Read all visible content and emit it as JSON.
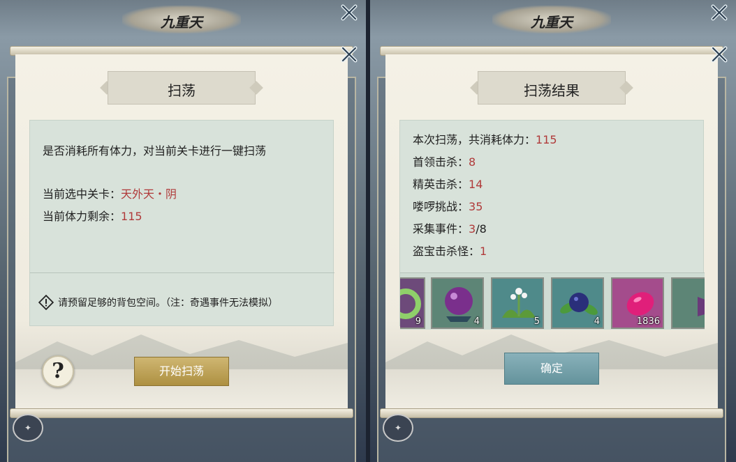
{
  "top_banner_title": "九重天",
  "left": {
    "dialog_title": "扫荡",
    "message": "是否消耗所有体力，对当前关卡进行一键扫荡",
    "selected_stage_label": "当前选中关卡：",
    "selected_stage_value": "天外天・阴",
    "stamina_label": "当前体力剩余：",
    "stamina_value": "115",
    "warning_text": "请预留足够的背包空间。（注：奇遇事件无法模拟）",
    "start_button": "开始扫荡",
    "help_button": "?"
  },
  "right": {
    "dialog_title": "扫荡结果",
    "summary_label": "本次扫荡，共消耗体力：",
    "summary_value": "115",
    "stats": [
      {
        "label": "首领击杀：",
        "value": "8",
        "suffix": ""
      },
      {
        "label": "精英击杀：",
        "value": "14",
        "suffix": ""
      },
      {
        "label": "喽啰挑战：",
        "value": "35",
        "suffix": ""
      },
      {
        "label": "采集事件：",
        "value": "3",
        "suffix": "/8"
      },
      {
        "label": "盗宝击杀怪：",
        "value": "1",
        "suffix": ""
      }
    ],
    "items": [
      {
        "icon": "green-jade-ring-icon",
        "count": "9"
      },
      {
        "icon": "purple-orb-on-stand-icon",
        "count": "4"
      },
      {
        "icon": "white-flower-herb-icon",
        "count": "5"
      },
      {
        "icon": "blue-berry-leaves-icon",
        "count": "4"
      },
      {
        "icon": "pink-gem-icon",
        "count": "1836"
      },
      {
        "icon": "purple-crystal-icon",
        "count": ""
      }
    ],
    "confirm_button": "确定"
  },
  "colors": {
    "highlight_red": "#b03a3a",
    "gold_button": "#bfa157",
    "teal_button": "#76a2ab",
    "panel": "#d8e2da"
  }
}
